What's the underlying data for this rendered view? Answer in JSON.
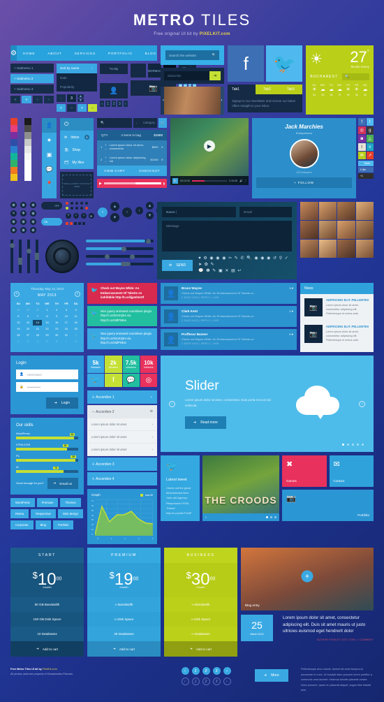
{
  "header": {
    "title_bold": "METRO",
    "title_thin": " TILES",
    "subtitle_pre": "Free original UI kit by ",
    "subtitle_brand": "PIXELKIT",
    "subtitle_post": ".com"
  },
  "nav": {
    "items": [
      "HOME",
      "ABOUT",
      "SERVICES",
      "PORTFOLIO",
      "BLOG",
      "CONTACT"
    ],
    "gear_icon": "gear-icon"
  },
  "submenu": {
    "items": [
      "+ Submenu 1",
      "+ Submenu 2",
      "+ Submenu 3"
    ],
    "active_index": 1
  },
  "pager_small": [
    "«",
    "»",
    "‹",
    "›"
  ],
  "sort": {
    "value": "Sort by name",
    "options": [
      "Date",
      "Popularity"
    ]
  },
  "stepper": {
    "minus": "-",
    "value": "3",
    "plus": "+"
  },
  "tooltip": {
    "label": "Tooltip"
  },
  "toggle_buttons": {
    "normal": "NORMAL",
    "pushed": "PUSHED"
  },
  "perpage": {
    "value": "12 per page"
  },
  "pagination_row": [
    "‹",
    "1",
    "2",
    "3",
    "›"
  ],
  "search": {
    "placeholder": "Search the website",
    "icon": "search-icon"
  },
  "subscribe": {
    "placeholder": "Subscribe",
    "button_icon": "arrow-right-icon"
  },
  "social_tiles": [
    {
      "name": "facebook-tile",
      "glyph": "f"
    },
    {
      "name": "twitter-tile",
      "glyph": "t"
    }
  ],
  "weather": {
    "temp": "27",
    "degree": "°",
    "condition": "Mostly Sunny",
    "city": "BUCHAREST",
    "search_icon": "search-icon",
    "days": [
      {
        "d": "SU",
        "i": "☀",
        "v": "31"
      },
      {
        "d": "MO",
        "i": "☁",
        "v": "20"
      },
      {
        "d": "TU",
        "i": "☁",
        "v": "25"
      },
      {
        "d": "WE",
        "i": "☁",
        "v": "27"
      },
      {
        "d": "TH",
        "i": "☀",
        "v": "29"
      },
      {
        "d": "FR",
        "i": "☀",
        "v": "32"
      },
      {
        "d": "SA",
        "i": "☁",
        "v": "24"
      }
    ]
  },
  "tabs": {
    "items": [
      "Tab1",
      "Tab2",
      "Tab3"
    ],
    "active": 0,
    "body": "Signup to our newsletter and recieve our latest offers straight to your inbox."
  },
  "carousel": {
    "prev": "‹",
    "next": "›"
  },
  "palette": [
    "#e8402a",
    "#1a1a1a",
    "#b63d9e",
    "#4a4a4a",
    "#7a2fa0",
    "#8f8f8f",
    "#2e4fa8",
    "#c9c9c9",
    "#13b59a",
    "#e6e6e6",
    "#3aa9e3",
    "#f5f5f5",
    "#f07a1f",
    "#ffffff",
    "#f2c31a",
    "#dddddd"
  ],
  "rail_icons": [
    "user-icon",
    "star-icon",
    "image-icon",
    "comment-icon",
    "pin-icon"
  ],
  "side_menu": {
    "header_icon": "power-icon",
    "items": [
      {
        "label": "Inbox",
        "icon": "envelope-icon",
        "badge": "8"
      },
      {
        "label": "Shop",
        "icon": "bag-icon",
        "badge": ""
      },
      {
        "label": "My files",
        "icon": "files-icon",
        "badge": ""
      }
    ],
    "dropzone": "DRAG & DROP YOUR FILE HERE"
  },
  "shop": {
    "search_placeholder": "",
    "category": "Category",
    "cart_icon": "cart-icon",
    "cart_header": {
      "qty": "QTY.",
      "items": "2 items in bag",
      "total": "$1500"
    },
    "cart_rows": [
      {
        "n": "1",
        "title": "Lorem ipsum dolor sit amet, consectetur",
        "price": "$500"
      },
      {
        "n": "2",
        "title": "Lorem ipsum dolor adipiscing elit",
        "price": "$1000"
      }
    ],
    "buttons": {
      "view": "VIEW CART",
      "checkout": "CHECKOUT"
    }
  },
  "player": {
    "current": "00:15:35",
    "duration": "2:15:35",
    "play_icon": "play-icon",
    "volume_icon": "volume-icon",
    "fullscreen_icon": "fullscreen-icon"
  },
  "profile": {
    "name": "Jack Marchies",
    "role": "Entrepreneur",
    "followers": "125 followers",
    "follow": "+ FOLLOW",
    "socials": [
      {
        "g": "f",
        "c": "#3d6fb5"
      },
      {
        "g": "t",
        "c": "#4fb9ef"
      },
      {
        "g": "◎",
        "c": "#d2335c"
      },
      {
        "g": "g+",
        "c": "#3a3a3a"
      },
      {
        "g": "in",
        "c": "#7a2fa0"
      },
      {
        "g": "△",
        "c": "#4caf50"
      },
      {
        "g": "t",
        "c": "#e8e3d8"
      },
      {
        "g": "v",
        "c": "#1fa8c4"
      },
      {
        "g": "✉",
        "c": "#b9cf18"
      },
      {
        "g": "↗",
        "c": "#e8402a"
      }
    ],
    "tweet_btn": "Tweet",
    "like_btn": "Like",
    "plus_btn": "+1"
  },
  "contact_form": {
    "name_label": "Name",
    "email_label": "Email",
    "message_label": "Message",
    "send": "SEND",
    "send_icon": "envelope-icon"
  },
  "calendar": {
    "today": "Thursday, May 14, 2013",
    "month": "MAY 2013",
    "prev": "‹",
    "next": "›",
    "weekdays": [
      "SU",
      "MO",
      "TU",
      "WE",
      "TH",
      "FR",
      "SA"
    ],
    "weeks": [
      [
        "28",
        "29",
        "30",
        "1",
        "2",
        "3",
        "4"
      ],
      [
        "5",
        "6",
        "7",
        "8",
        "9",
        "10",
        "11"
      ],
      [
        "12",
        "13",
        "14",
        "15",
        "16",
        "17",
        "18"
      ],
      [
        "19",
        "20",
        "21",
        "22",
        "23",
        "24",
        "25"
      ],
      [
        "26",
        "27",
        "28",
        "29",
        "30",
        "31",
        "1"
      ],
      [
        "2",
        "3",
        "4",
        "5",
        "6",
        "7",
        "8"
      ]
    ],
    "selected": "14"
  },
  "tweets": [
    {
      "text": "Check out Wayne White: An Embarrassment Of Talents on indribbble http://t.co/kjpmhmOf",
      "bg": "#d8294f",
      "icon": "twitter-icon"
    },
    {
      "text": "Nice jquery animated countdown plugin http://t.co/SZxXQKo via http://t.co/2tdlPNEw",
      "bg": "#21bfa0",
      "icon": "twitter-icon"
    },
    {
      "text": "Nice jquery animated countdown plugin http://t.co/SZxXQKo via http://t.co/2tdlPNEw",
      "bg": "#3aa9e3",
      "icon": "twitter-icon"
    }
  ],
  "comments": [
    {
      "name": "Bruce Wayne",
      "text": "Check out Wayne White: An Embarrassment Of Talents on",
      "meta": "2 DAYS AGO  |  REPLY  |  LIKE",
      "likes": "3"
    },
    {
      "name": "Clark Kent",
      "text": "Check out Wayne White: An Embarrassment Of Talents on",
      "meta": "2 DAYS AGO  |  REPLY  |  LIKE",
      "likes": "1"
    },
    {
      "name": "Proffesor Banner",
      "text": "Check out Wayne White: An Embarrassment Of Talents on",
      "meta": "2 DAYS AGO  |  REPLY  |  LIKE",
      "likes": "0"
    }
  ],
  "news": {
    "title": "News",
    "items": [
      {
        "title": "ADIPISCING ELIT. PELLENTES",
        "body": "Lorem ipsum dolor sit amet, consectetur adipiscing elit. Pellentesque et metus ante."
      },
      {
        "title": "ADIPISCING ELIT. PELLENTES",
        "body": "Lorem ipsum dolor sit amet, consectetur adipiscing elit. Pellentesque et metus ante."
      }
    ]
  },
  "login": {
    "title": "Login",
    "username_placeholder": "Username",
    "password_value": "••••••••••••",
    "button": "Login",
    "user_icon": "user-icon",
    "lock-icon": "lock-icon"
  },
  "skills": {
    "title": "Our skills",
    "items": [
      {
        "label": "WordPress",
        "value": "93"
      },
      {
        "label": "HTML/CSS",
        "value": "82"
      },
      {
        "label": "Ps",
        "value": "95"
      },
      {
        "label": "Ai",
        "value": "76"
      }
    ],
    "cta_text": "Good enough for you?",
    "cta_button": "Email us"
  },
  "tags": [
    "WordPress",
    "Premium",
    "Themes",
    "Retina",
    "Responsive",
    "Web design",
    "Corporate",
    "Blog",
    "Portfolio"
  ],
  "stats": [
    {
      "n": "5k",
      "l": "followers",
      "c": "#3aa9e3",
      "icon": "t"
    },
    {
      "n": "2k",
      "l": "followers",
      "c": "#c5e034",
      "icon": "f"
    },
    {
      "n": "7.5k",
      "l": "members",
      "c": "#21bfa0",
      "icon": "◉"
    },
    {
      "n": "10k",
      "l": "followers",
      "c": "#e8315c",
      "icon": "◎"
    }
  ],
  "accordion": {
    "closed_top": "Accordion 1",
    "open": "Accordion 2",
    "rows": [
      "Lorem ipsum dolor sit amet",
      "Lorem ipsum dolor sit amet",
      "Lorem ipsum dolor sit amet"
    ],
    "closed_bottom": [
      "Accordion 3",
      "Accordion 4"
    ]
  },
  "slider": {
    "title": "Slider",
    "text": "Lorem ipsum dolor sit amet, consectetur. Duis porta eros at nisl vehicula.",
    "button": "Read more",
    "prev": "‹",
    "next": "›",
    "dots": 5,
    "active_dot": 0,
    "cloud_icon": "cloud-download-icon"
  },
  "graph": {
    "title": "Graph",
    "legend": "max 50",
    "y_ticks": [
      "70",
      "60",
      "50",
      "40",
      "30",
      "20",
      "10",
      "5"
    ],
    "x_ticks": [
      "0",
      "1",
      "2",
      "3",
      "4"
    ],
    "values": [
      5,
      50,
      25,
      36,
      36,
      44,
      30,
      23,
      22
    ]
  },
  "latest_tweet": {
    "title": "Latest tweet",
    "text": "Check out the great #themeforest item 'Inter-akt Agency - Responsive HTML Theme' http://t.co/m5cTCMP",
    "icon": "twitter-icon"
  },
  "portfolio_carousel": {
    "caption": "THE CROODS",
    "prev": "‹",
    "dots": 3
  },
  "tiles": [
    {
      "label": "Games",
      "icon": "xbox-icon",
      "bg": "#e8315c"
    },
    {
      "label": "Contact",
      "icon": "envelope-icon",
      "bg": "#2fa2dc"
    },
    {
      "label": "Portfolio",
      "icon": "camera-icon",
      "bg": "#2b96d4"
    }
  ],
  "pricing": [
    {
      "name": "START",
      "currency": "$",
      "amount": "10",
      "cents": "00",
      "period": "/month",
      "features": [
        "60 GB Bandwidth",
        "100 GB Disk Space",
        "10 Databases"
      ],
      "cta": "Add to cart",
      "head_bg": "#1b5e8c",
      "body_bg": "#17547e",
      "foot_bg": "#113f61",
      "row_bg": "#195a86"
    },
    {
      "name": "PREMIUM",
      "currency": "$",
      "amount": "19",
      "cents": "00",
      "period": "/month",
      "features": [
        "∞ Bandwidth",
        "∞ Disk Space",
        "25 Databases"
      ],
      "cta": "Add to cart",
      "head_bg": "#36a9e0",
      "body_bg": "#2fa0d8",
      "foot_bg": "#2a8cc0",
      "row_bg": "#33a4dc"
    },
    {
      "name": "BUSINESS",
      "currency": "$",
      "amount": "30",
      "cents": "00",
      "period": "/month",
      "features": [
        "∞ Bandwidth",
        "∞ Disk Space",
        "∞ Databases"
      ],
      "cta": "Add to cart",
      "head_bg": "#bfd41c",
      "body_bg": "#b7cc17",
      "foot_bg": "#8f9f11",
      "row_bg": "#bbd019"
    }
  ],
  "blog": {
    "caption": "Blog entry",
    "day": "25",
    "month": "March 2013",
    "excerpt": "Lorem ipsum dolor sit amet, consectetur adipiscing elit. Duis sit amet mauris ut justo ultricies euismod eget hendrerit dolor",
    "meta": "AUTHOR PIXELKIT-DOT-COM  •  1 COMMENT",
    "plus_icon": "plus-icon"
  },
  "footer": {
    "line1_bold": "Free Metro Tiles UI kit by ",
    "line1_brand": "PixelKit.com",
    "line2": "All photos used are property of Dreamworks Pictures.",
    "pagination_filled": [
      "‹",
      "1",
      "2",
      "3",
      "›"
    ],
    "pagination_outline": [
      "‹",
      "1",
      "2",
      "3",
      "›"
    ],
    "more_button": "More",
    "text": "Pellentesque arcu mauris, laoreet sit amet tempus id, accumsan in nunc. Ut suscipit diam posuere lorem porttitor a commodo urna laoreet. Vivamus lobortis placerat ornare. Nunc posuere, quam eu placerat aliquet, augue felis blandit sem."
  }
}
